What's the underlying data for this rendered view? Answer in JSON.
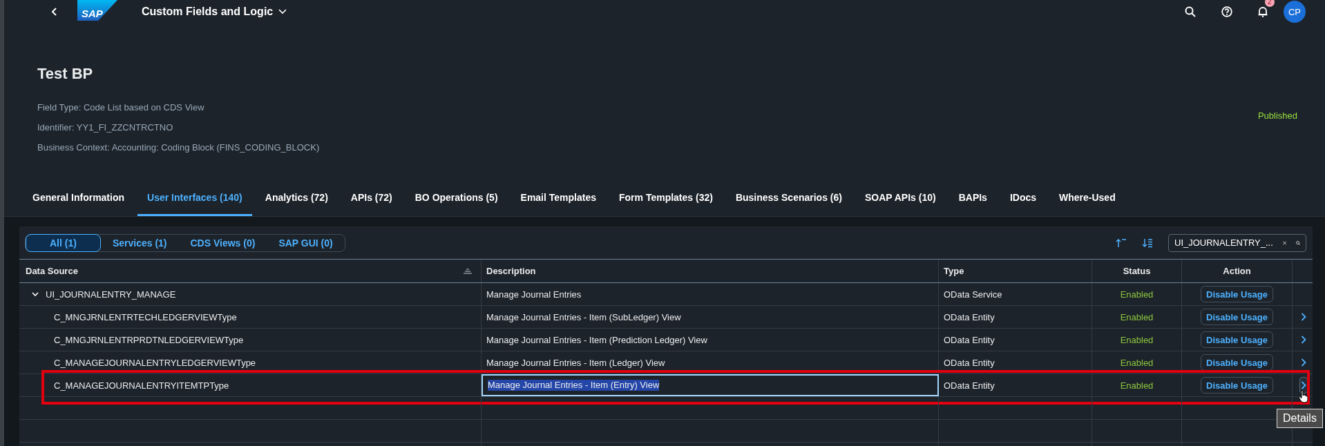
{
  "shell": {
    "logo": "SAP",
    "title": "Custom Fields and Logic",
    "notification_count": "2",
    "avatar": "CP"
  },
  "header": {
    "title": "Test BP",
    "status": "Published",
    "attributes": [
      "Field Type: Code List based on CDS View",
      "Identifier: YY1_FI_ZZCNTRCTNO",
      "Business Context: Accounting: Coding Block (FINS_CODING_BLOCK)"
    ]
  },
  "tabs": [
    {
      "label": "General Information",
      "selected": false
    },
    {
      "label": "User Interfaces (140)",
      "selected": true
    },
    {
      "label": "Analytics (72)",
      "selected": false
    },
    {
      "label": "APIs (72)",
      "selected": false
    },
    {
      "label": "BO Operations (5)",
      "selected": false
    },
    {
      "label": "Email Templates",
      "selected": false
    },
    {
      "label": "Form Templates (32)",
      "selected": false
    },
    {
      "label": "Business Scenarios (6)",
      "selected": false
    },
    {
      "label": "SOAP APIs (10)",
      "selected": false
    },
    {
      "label": "BAPIs",
      "selected": false
    },
    {
      "label": "IDocs",
      "selected": false
    },
    {
      "label": "Where-Used",
      "selected": false
    }
  ],
  "filters": [
    {
      "label": "All (1)",
      "selected": true
    },
    {
      "label": "Services (1)",
      "selected": false
    },
    {
      "label": "CDS Views (0)",
      "selected": false
    },
    {
      "label": "SAP GUI (0)",
      "selected": false
    }
  ],
  "search": {
    "value": "UI_JOURNALENTRY_..."
  },
  "table": {
    "columns": [
      "Data Source",
      "Description",
      "Type",
      "Status",
      "Action"
    ],
    "rows": [
      {
        "name": "UI_JOURNALENTRY_MANAGE",
        "description": "Manage Journal Entries",
        "type": "OData Service",
        "status": "Enabled",
        "action": "Disable Usage",
        "expanded": true,
        "children": [
          {
            "name": "C_MNGJRNLENTRTECHLEDGERVIEWType",
            "description": "Manage Journal Entries - Item (SubLedger) View",
            "type": "OData Entity",
            "status": "Enabled",
            "action": "Disable Usage",
            "focused": false,
            "hovered": false
          },
          {
            "name": "C_MNGJRNLENTRPRDTNLEDGERVIEWType",
            "description": "Manage Journal Entries - Item (Prediction Ledger) View",
            "type": "OData Entity",
            "status": "Enabled",
            "action": "Disable Usage",
            "focused": false,
            "hovered": false
          },
          {
            "name": "C_MANAGEJOURNALENTRYLEDGERVIEWType",
            "description": "Manage Journal Entries - Item (Ledger) View",
            "type": "OData Entity",
            "status": "Enabled",
            "action": "Disable Usage",
            "focused": false,
            "hovered": false
          },
          {
            "name": "C_MANAGEJOURNALENTRYITEMTPType",
            "description": "Manage Journal Entries - Item (Entry) View",
            "type": "OData Entity",
            "status": "Enabled",
            "action": "Disable Usage",
            "focused": true,
            "hovered": true
          }
        ]
      }
    ]
  },
  "tooltip": "Details"
}
